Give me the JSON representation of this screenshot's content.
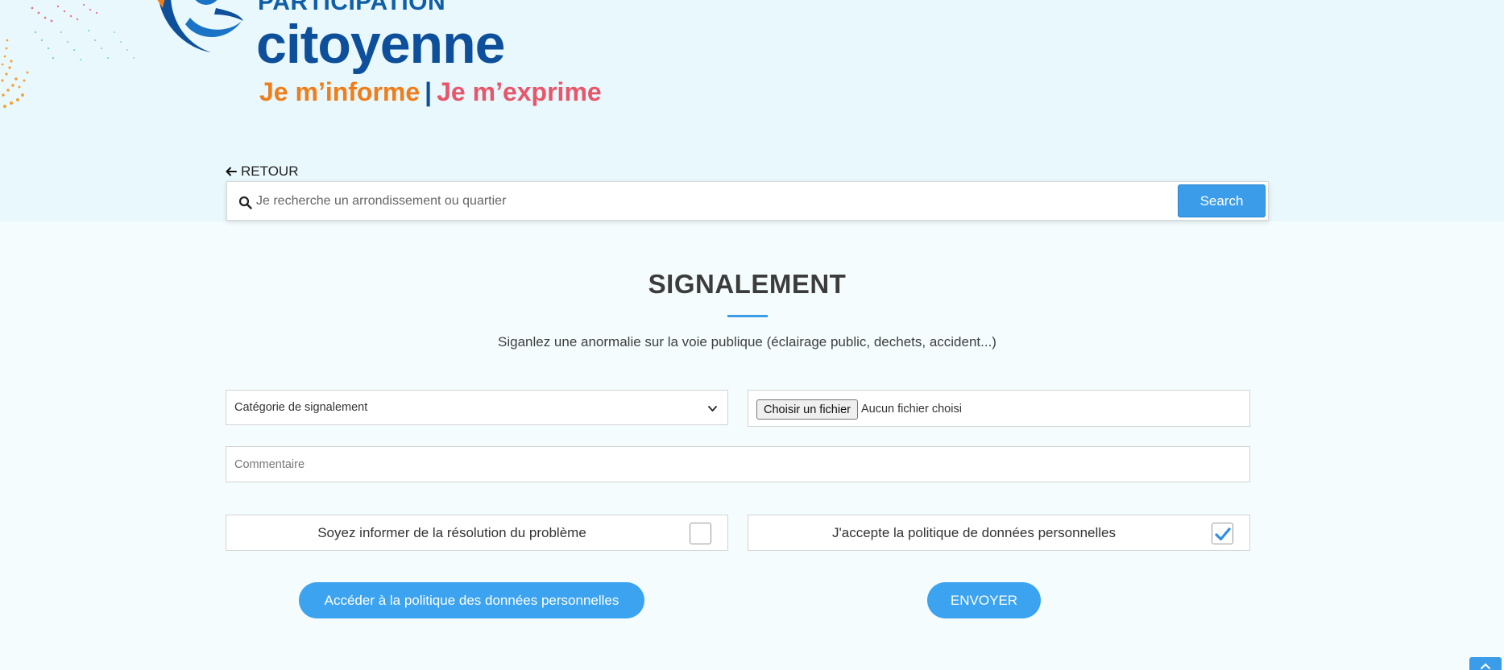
{
  "header": {
    "logo_line1": "PARTICIPATION",
    "logo_line2": "citoyenne",
    "tagline_part1": "Je m’informe",
    "tagline_separator": "|",
    "tagline_part2": "Je m’exprime"
  },
  "nav": {
    "back_label": "RETOUR"
  },
  "search": {
    "placeholder": "Je recherche un arrondissement ou quartier",
    "value": "",
    "button_label": "Search"
  },
  "main": {
    "title": "SIGNALEMENT",
    "subtitle": "Siganlez une anormalie sur la voie publique (éclairage public, dechets, accident...)"
  },
  "form": {
    "category_select": {
      "selected": "Catégorie de signalement"
    },
    "file_upload": {
      "button_label": "Choisir un fichier",
      "status": "Aucun fichier choisi"
    },
    "comment": {
      "placeholder": "Commentaire",
      "value": ""
    },
    "notify_checkbox": {
      "label": "Soyez informer de la résolution du problème",
      "checked": false
    },
    "policy_checkbox": {
      "label": "J'accepte la politique de données personnelles",
      "checked": true
    },
    "policy_button_label": "Accéder à la politique des données personnelles",
    "send_button_label": "ENVOYER"
  },
  "icons": {
    "back": "arrow-left-icon",
    "search": "search-icon",
    "select": "chevron-down-icon",
    "check": "checkmark-icon",
    "scroll_top": "chevron-up-icon"
  },
  "colors": {
    "accent": "#3b9de9",
    "logo_blue": "#0d4f9a",
    "tag_orange": "#ef7d1a",
    "tag_pink": "#e7566a",
    "hero_bg": "#e9f8fc"
  }
}
